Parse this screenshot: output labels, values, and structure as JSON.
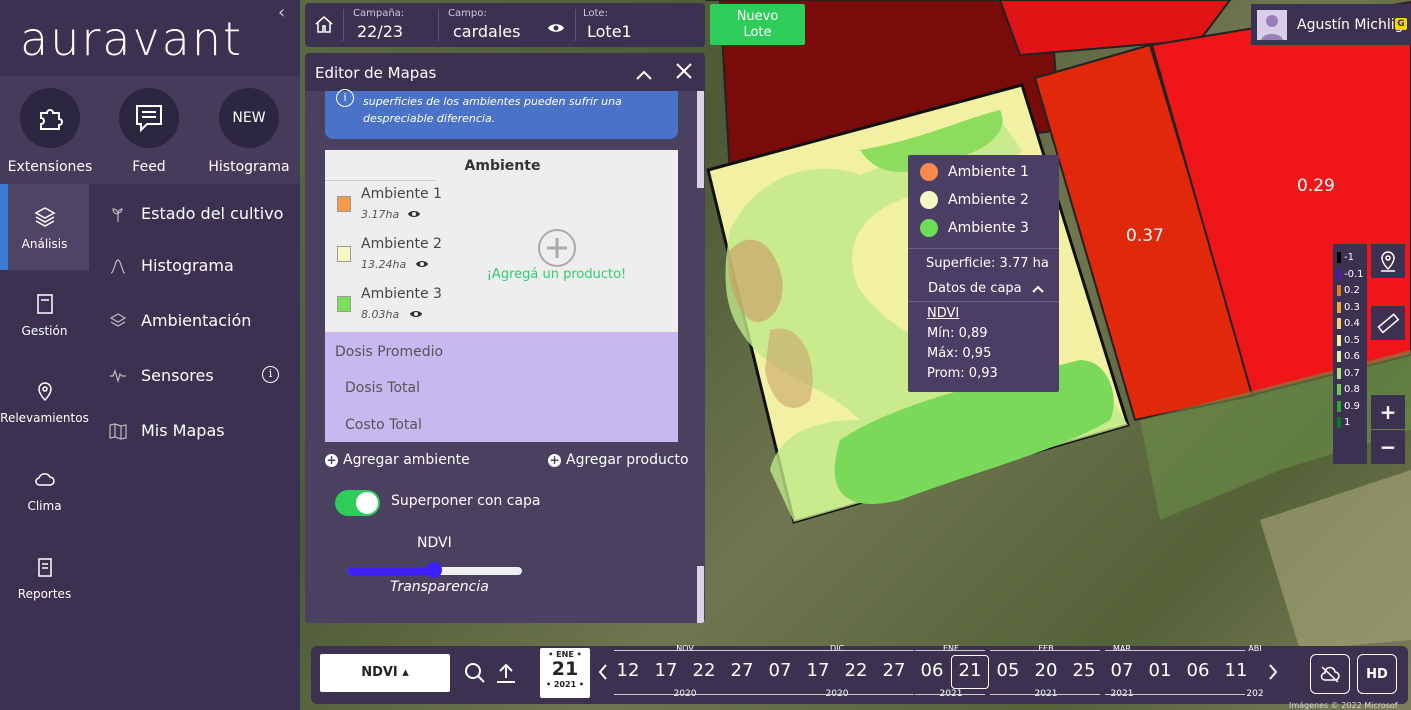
{
  "app": {
    "logo": "auravant"
  },
  "quick_actions": [
    {
      "label": "Extensiones",
      "icon": "puzzle-icon"
    },
    {
      "label": "Feed",
      "icon": "chat-icon"
    },
    {
      "label": "Histograma",
      "badge": "NEW"
    }
  ],
  "rail": [
    {
      "label": "Análisis",
      "icon": "layers-icon",
      "active": true
    },
    {
      "label": "Gestión",
      "icon": "notebook-icon"
    },
    {
      "label": "Relevamientos",
      "icon": "pin-icon"
    },
    {
      "label": "Clima",
      "icon": "cloud-icon"
    },
    {
      "label": "Reportes",
      "icon": "clipboard-icon"
    }
  ],
  "submenu": [
    {
      "label": "Estado del cultivo",
      "icon": "plant-icon"
    },
    {
      "label": "Histograma",
      "icon": "curve-icon"
    },
    {
      "label": "Ambientación",
      "icon": "stack-icon"
    },
    {
      "label": "Sensores",
      "icon": "wave-icon",
      "info": "i"
    },
    {
      "label": "Mis Mapas",
      "icon": "map-icon"
    }
  ],
  "topbar": {
    "campana_label": "Campaña:",
    "campana_value": "22/23",
    "campo_label": "Campo:",
    "campo_value": "cardales",
    "lote_label": "Lote:",
    "lote_value": "Lote1",
    "nuevo_lote": [
      "Nuevo",
      "Lote"
    ]
  },
  "user": {
    "name": "Agustín Michlig",
    "badge": "G"
  },
  "editor": {
    "title": "Editor de Mapas",
    "info_text": [
      "superficies de los ambientes pueden sufrir una",
      "despreciable diferencia."
    ],
    "table_header": "Ambiente",
    "ambientes": [
      {
        "name": "Ambiente 1",
        "area": "3.17ha",
        "color": "#f59a4b"
      },
      {
        "name": "Ambiente 2",
        "area": "13.24ha",
        "color": "#f7f7c4"
      },
      {
        "name": "Ambiente 3",
        "area": "8.03ha",
        "color": "#7cdc5c"
      }
    ],
    "add_product_cta": "¡Agregá un producto!",
    "dosis_promedio": "Dosis Promedio",
    "dosis_total": "Dosis Total",
    "costo_total": "Costo Total",
    "add_ambiente": "Agregar ambiente",
    "add_producto": "Agregar producto",
    "overlay_label": "Superponer con capa",
    "overlay_on": true,
    "layer_name": "NDVI",
    "transparency_label": "Transparencia",
    "transparency_value": 0.5
  },
  "tooltip": {
    "legend": [
      {
        "name": "Ambiente 1",
        "color": "#f58a4b"
      },
      {
        "name": "Ambiente 2",
        "color": "#f7f7c4"
      },
      {
        "name": "Ambiente 3",
        "color": "#6edc55"
      }
    ],
    "superficie": "Superficie: 3.77 ha",
    "datos_capa": "Datos de capa",
    "layer": "NDVI",
    "min": "Mín: 0,89",
    "max": "Máx: 0,95",
    "prom": "Prom: 0,93"
  },
  "map_labels": {
    "field_a": "0.37",
    "field_b": "0.29"
  },
  "scale": [
    {
      "v": "-1",
      "c": "#000000"
    },
    {
      "v": "-0.1",
      "c": "#4a1bb5"
    },
    {
      "v": "0.2",
      "c": "#e07a1f"
    },
    {
      "v": "0.3",
      "c": "#f0a645"
    },
    {
      "v": "0.4",
      "c": "#f7cf7a"
    },
    {
      "v": "0.5",
      "c": "#f5f2a8"
    },
    {
      "v": "0.6",
      "c": "#dff0b4"
    },
    {
      "v": "0.7",
      "c": "#a9e08a"
    },
    {
      "v": "0.8",
      "c": "#6cc85a"
    },
    {
      "v": "0.9",
      "c": "#2fa83b"
    },
    {
      "v": "1",
      "c": "#0a7a1c"
    }
  ],
  "zoom": {
    "in": "+",
    "out": "−"
  },
  "bottom": {
    "layer_select": "NDVI ▴",
    "date_card": {
      "month": "• ENE •",
      "day": "21",
      "year": "• 2021 •"
    },
    "days": [
      "12",
      "17",
      "22",
      "27",
      "07",
      "17",
      "22",
      "27",
      "06",
      "21",
      "05",
      "20",
      "25",
      "07",
      "01",
      "06",
      "11"
    ],
    "selected_day_index": 9,
    "months": [
      "NOV",
      "DIC",
      "ENE",
      "FEB",
      "MAR",
      "ABI"
    ],
    "years": [
      "2020",
      "2020",
      "2021",
      "2021",
      "2021",
      "202"
    ],
    "hd": "HD",
    "copyright": "Imágenes © 2022 Microsof"
  }
}
